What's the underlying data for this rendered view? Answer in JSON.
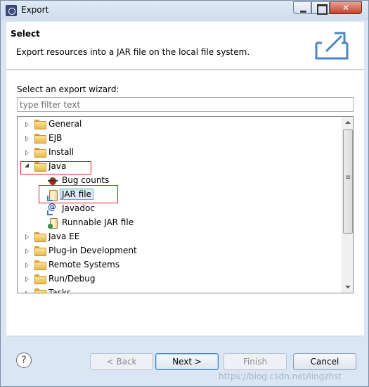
{
  "window": {
    "title": "Export"
  },
  "header": {
    "title": "Select",
    "description": "Export resources into a JAR file on the local file system."
  },
  "main": {
    "wizard_label": "Select an export wizard:",
    "filter_placeholder": "type filter text",
    "filter_value": "",
    "tree": {
      "items": [
        {
          "label": "General"
        },
        {
          "label": "EJB"
        },
        {
          "label": "Install"
        },
        {
          "label": "Java"
        },
        {
          "label": "Bug counts"
        },
        {
          "label": "JAR file"
        },
        {
          "label": "Javadoc"
        },
        {
          "label": "Runnable JAR file"
        },
        {
          "label": "Java EE"
        },
        {
          "label": "Plug-in Development"
        },
        {
          "label": "Remote Systems"
        },
        {
          "label": "Run/Debug"
        },
        {
          "label": "Tasks"
        }
      ]
    }
  },
  "footer": {
    "help_symbol": "?",
    "back_label": "< Back",
    "next_label": "Next >",
    "finish_label": "Finish",
    "cancel_label": "Cancel",
    "watermark": "https://blog.csdn.net/lingzhst"
  },
  "colors": {
    "highlight_box": "#e02020",
    "selection_bg": "#dcebfc"
  }
}
